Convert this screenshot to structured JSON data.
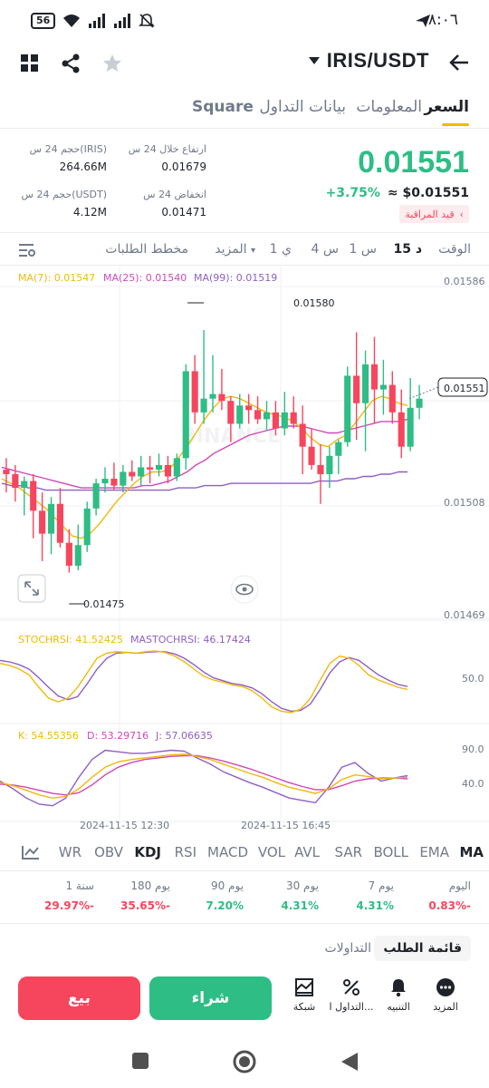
{
  "status": {
    "time": "٨:٠٦",
    "battery": "56"
  },
  "header": {
    "pair": "IRIS/USDT"
  },
  "tabs": [
    {
      "label": "السعر",
      "active": true
    },
    {
      "label": "المعلومات",
      "active": false
    },
    {
      "label": "بيانات التداول",
      "active": false
    },
    {
      "label": "Square",
      "active": false
    }
  ],
  "ticker": {
    "last_price": "0.01551",
    "change": "+3.75%",
    "usd_price": "≈ $0.01551",
    "watch_badge": "قيد المراقبة",
    "high_label": "ارتفاع خلال 24 س",
    "high_value": "0.01679",
    "low_label": "انخفاض 24 س",
    "low_value": "0.01471",
    "vol_iris_label": "حجم 24 س(IRIS)",
    "vol_iris_value": "264.66M",
    "vol_usdt_label": "حجم 24 س(USDT)",
    "vol_usdt_value": "4.12M"
  },
  "timeframes": {
    "time_label": "الوقت",
    "items": [
      "15 د",
      "1 س",
      "4 س",
      "1 ي"
    ],
    "active": "15 د",
    "more": "المزيد",
    "depth": "مخطط الطلبات"
  },
  "chart_data": {
    "type": "candlestick",
    "ma_legend": {
      "ma7": "MA(7): 0.01547",
      "ma25": "MA(25): 0.01540",
      "ma99": "MA(99): 0.01519"
    },
    "y_ticks": [
      "0.01586",
      "0.01508",
      "0.01469"
    ],
    "y_range": [
      0.01455,
      0.016
    ],
    "current_price_tag": "0.01551",
    "high_marker": "0.01580",
    "low_marker": "0.01475",
    "candles": [
      [
        0.0152,
        0.01525,
        0.0151,
        0.01518
      ],
      [
        0.01518,
        0.01522,
        0.01506,
        0.01512
      ],
      [
        0.01512,
        0.01517,
        0.015,
        0.01515
      ],
      [
        0.01515,
        0.01518,
        0.0149,
        0.01502
      ],
      [
        0.01502,
        0.0151,
        0.0148,
        0.01492
      ],
      [
        0.01492,
        0.01508,
        0.01483,
        0.01505
      ],
      [
        0.01505,
        0.01512,
        0.01486,
        0.01488
      ],
      [
        0.01488,
        0.01494,
        0.01475,
        0.01478
      ],
      [
        0.01478,
        0.01496,
        0.01476,
        0.01487
      ],
      [
        0.01487,
        0.01506,
        0.01484,
        0.01503
      ],
      [
        0.01503,
        0.01516,
        0.015,
        0.01514
      ],
      [
        0.01514,
        0.01521,
        0.0151,
        0.01516
      ],
      [
        0.01516,
        0.01523,
        0.01511,
        0.01513
      ],
      [
        0.01513,
        0.01522,
        0.0151,
        0.01519
      ],
      [
        0.01519,
        0.01524,
        0.01515,
        0.01517
      ],
      [
        0.01517,
        0.01526,
        0.01513,
        0.01521
      ],
      [
        0.01521,
        0.01526,
        0.01514,
        0.0152
      ],
      [
        0.0152,
        0.01527,
        0.01517,
        0.01522
      ],
      [
        0.01522,
        0.01526,
        0.01514,
        0.01517
      ],
      [
        0.01517,
        0.01527,
        0.01515,
        0.01525
      ],
      [
        0.01525,
        0.01566,
        0.0152,
        0.01563
      ],
      [
        0.01563,
        0.0157,
        0.0154,
        0.01545
      ],
      [
        0.01545,
        0.01581,
        0.0154,
        0.01551
      ],
      [
        0.01551,
        0.0157,
        0.01545,
        0.01553
      ],
      [
        0.01553,
        0.01564,
        0.01546,
        0.0155
      ],
      [
        0.0155,
        0.01552,
        0.01532,
        0.0154
      ],
      [
        0.0154,
        0.01553,
        0.01538,
        0.01548
      ],
      [
        0.01548,
        0.01553,
        0.0154,
        0.01546
      ],
      [
        0.01546,
        0.01552,
        0.0154,
        0.01542
      ],
      [
        0.01542,
        0.0155,
        0.01537,
        0.01545
      ],
      [
        0.01545,
        0.0155,
        0.01535,
        0.01538
      ],
      [
        0.01538,
        0.01554,
        0.01535,
        0.01545
      ],
      [
        0.01545,
        0.01552,
        0.01538,
        0.0154
      ],
      [
        0.0154,
        0.01548,
        0.01518,
        0.0153
      ],
      [
        0.0153,
        0.01538,
        0.0152,
        0.01522
      ],
      [
        0.01522,
        0.01531,
        0.01505,
        0.01518
      ],
      [
        0.01518,
        0.0153,
        0.01512,
        0.01526
      ],
      [
        0.01526,
        0.01533,
        0.01518,
        0.01532
      ],
      [
        0.01532,
        0.01565,
        0.0153,
        0.01561
      ],
      [
        0.01561,
        0.0158,
        0.01533,
        0.01549
      ],
      [
        0.01549,
        0.01572,
        0.01528,
        0.01566
      ],
      [
        0.01566,
        0.01578,
        0.0154,
        0.01555
      ],
      [
        0.01555,
        0.01568,
        0.01544,
        0.01557
      ],
      [
        0.01557,
        0.01563,
        0.0154,
        0.01545
      ],
      [
        0.01545,
        0.01555,
        0.01525,
        0.0153
      ],
      [
        0.0153,
        0.0156,
        0.01528,
        0.01547
      ],
      [
        0.01547,
        0.01557,
        0.01542,
        0.01551
      ]
    ],
    "ma7": [
      0.01516,
      0.01514,
      0.01512,
      0.01509,
      0.01506,
      0.01503,
      0.01499,
      0.01495,
      0.01491,
      0.0149,
      0.01492,
      0.01496,
      0.01501,
      0.01506,
      0.0151,
      0.01514,
      0.01517,
      0.01519,
      0.01519,
      0.0152,
      0.01525,
      0.0153,
      0.01536,
      0.01542,
      0.01547,
      0.01551,
      0.01552,
      0.01551,
      0.01549,
      0.01547,
      0.01545,
      0.01544,
      0.01543,
      0.01541,
      0.01538,
      0.01534,
      0.01531,
      0.0153,
      0.01533,
      0.01535,
      0.0154,
      0.01545,
      0.0155,
      0.01552,
      0.01551,
      0.01549,
      0.01548
    ],
    "ma25": [
      0.01521,
      0.0152,
      0.01519,
      0.01518,
      0.01517,
      0.01516,
      0.01515,
      0.01514,
      0.01513,
      0.01512,
      0.01512,
      0.01512,
      0.01512,
      0.01512,
      0.01512,
      0.01512,
      0.01513,
      0.01513,
      0.01514,
      0.01515,
      0.01517,
      0.01519,
      0.01522,
      0.01524,
      0.01527,
      0.01529,
      0.01531,
      0.01533,
      0.01535,
      0.01536,
      0.01537,
      0.01538,
      0.01539,
      0.01539,
      0.01539,
      0.01538,
      0.01537,
      0.01536,
      0.01536,
      0.01537,
      0.01538,
      0.01539,
      0.0154,
      0.01541,
      0.01541,
      0.01541,
      0.01542
    ],
    "ma99": [
      0.01514,
      0.01513,
      0.01513,
      0.01512,
      0.01512,
      0.01511,
      0.01511,
      0.01511,
      0.01511,
      0.01511,
      0.01511,
      0.01511,
      0.01511,
      0.01511,
      0.01511,
      0.01511,
      0.01511,
      0.01511,
      0.01511,
      0.01511,
      0.01512,
      0.01512,
      0.01512,
      0.01513,
      0.01513,
      0.01513,
      0.01514,
      0.01514,
      0.01514,
      0.01514,
      0.01514,
      0.01514,
      0.01514,
      0.01514,
      0.01514,
      0.01514,
      0.01515,
      0.01515,
      0.01515,
      0.01516,
      0.01516,
      0.01517,
      0.01517,
      0.01518,
      0.01518,
      0.01519,
      0.01519
    ],
    "stochrsi": {
      "legend_k": "STOCHRSI: 41.52425",
      "legend_d": "MASTOCHRSI: 46.17424",
      "tick": "50.0",
      "k": [
        78,
        75,
        70,
        62,
        45,
        30,
        25,
        30,
        45,
        65,
        85,
        92,
        94,
        93,
        92,
        94,
        95,
        93,
        88,
        80,
        70,
        60,
        55,
        52,
        48,
        46,
        40,
        30,
        18,
        12,
        10,
        15,
        30,
        55,
        78,
        88,
        85,
        75,
        62,
        55,
        50,
        45,
        42
      ],
      "d": [
        82,
        80,
        76,
        70,
        58,
        45,
        33,
        28,
        32,
        50,
        70,
        85,
        92,
        93,
        92,
        93,
        94,
        94,
        91,
        85,
        76,
        66,
        58,
        54,
        50,
        48,
        44,
        36,
        25,
        16,
        12,
        13,
        22,
        42,
        65,
        80,
        86,
        82,
        72,
        62,
        55,
        49,
        46
      ]
    },
    "kdj": {
      "legend_k": "K: 54.55356",
      "legend_d": "D: 53.29716",
      "legend_j": "J: 57.06635",
      "ticks": [
        "90.0",
        "40.0"
      ],
      "k": [
        48,
        44,
        38,
        32,
        28,
        30,
        40,
        55,
        68,
        75,
        78,
        80,
        82,
        84,
        85,
        82,
        78,
        72,
        66,
        60,
        55,
        48,
        42,
        38,
        34,
        40,
        52,
        58,
        56,
        53,
        54,
        55
      ],
      "d": [
        46,
        45,
        42,
        38,
        34,
        32,
        35,
        45,
        58,
        68,
        74,
        78,
        80,
        82,
        83,
        83,
        80,
        76,
        71,
        66,
        60,
        54,
        48,
        43,
        39,
        39,
        44,
        50,
        53,
        54,
        54,
        53
      ],
      "j": [
        50,
        40,
        28,
        20,
        18,
        28,
        55,
        78,
        90,
        88,
        86,
        86,
        88,
        90,
        89,
        80,
        72,
        62,
        55,
        48,
        42,
        35,
        28,
        25,
        22,
        42,
        68,
        74,
        60,
        50,
        54,
        57
      ]
    },
    "x_ticks": [
      "2024-11-15 12:30",
      "2024-11-15 16:45"
    ],
    "watermark": "BINANCE"
  },
  "indicators": [
    "MA",
    "EMA",
    "BOLL",
    "SAR",
    "AVL",
    "VOL",
    "MACD",
    "RSI",
    "KDJ",
    "OBV",
    "WR"
  ],
  "indicators_active": "KDJ",
  "performance": [
    {
      "label": "اليوم",
      "value": "0.83%-",
      "color": "#f6465d"
    },
    {
      "label": "7 يوم",
      "value": "4.31%",
      "color": "#2ebd85"
    },
    {
      "label": "30 يوم",
      "value": "4.31%",
      "color": "#2ebd85"
    },
    {
      "label": "90 يوم",
      "value": "7.20%",
      "color": "#2ebd85"
    },
    {
      "label": "180 يوم",
      "value": "35.65%-",
      "color": "#f6465d"
    },
    {
      "label": "1 سنة",
      "value": "29.97%-",
      "color": "#f6465d"
    }
  ],
  "book_tabs": {
    "order_book": "قائمة الطلب",
    "trades": "التداولات"
  },
  "bottom": {
    "more": "المزيد",
    "alert": "التنبيه",
    "trade": "التداول ا...",
    "grid": "شبكة",
    "buy": "شراء",
    "sell": "بيع"
  },
  "colors": {
    "up": "#2ebd85",
    "down": "#f6465d",
    "ma7": "#f0b90b",
    "ma25": "#d147b8",
    "ma99": "#8e5fc7",
    "accent": "#f0b90b"
  }
}
